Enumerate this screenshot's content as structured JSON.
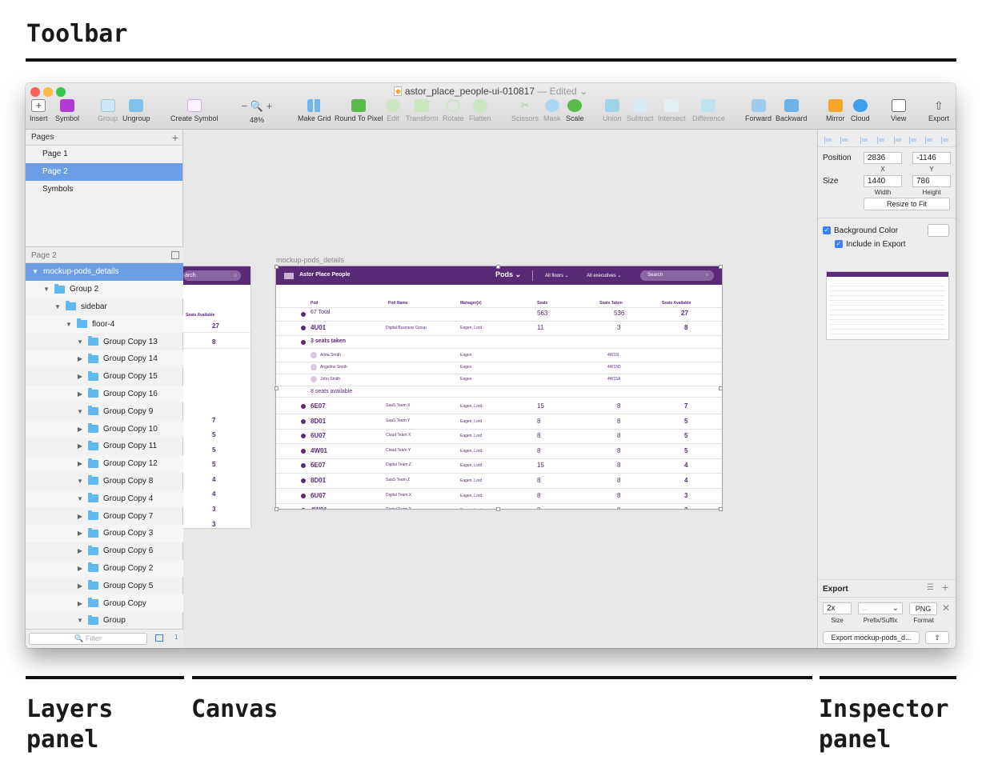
{
  "annotations": {
    "toolbar_heading": "Toolbar",
    "layers_heading": "Layers panel",
    "canvas_heading": "Canvas",
    "inspector_heading": "Inspector panel"
  },
  "window": {
    "title": "astor_place_people-ui-010817",
    "edited": "— Edited",
    "traffic_colors": [
      "#fc605b",
      "#fdbc40",
      "#34c84a"
    ]
  },
  "toolbar": {
    "insert": "Insert",
    "symbol": "Symbol",
    "group": "Group",
    "ungroup": "Ungroup",
    "create_symbol": "Create Symbol",
    "zoom": "48%",
    "make_grid": "Make Grid",
    "round_to_pixel": "Round To Pixel",
    "edit": "Edit",
    "transform": "Transform",
    "rotate": "Rotate",
    "flatten": "Flatten",
    "scissors": "Scissors",
    "mask": "Mask",
    "scale": "Scale",
    "union": "Union",
    "subtract": "Subtract",
    "intersect": "Intersect",
    "difference": "Difference",
    "forward": "Forward",
    "backward": "Backward",
    "mirror": "Mirror",
    "cloud": "Cloud",
    "view": "View",
    "export": "Export"
  },
  "layers_panel": {
    "pages_header": "Pages",
    "pages": [
      "Page 1",
      "Page 2",
      "Symbols"
    ],
    "selected_page": "Page 2",
    "current_page_label": "Page 2",
    "layers": [
      {
        "name": "mockup-pods_details",
        "level": 0,
        "expanded": true,
        "selected": true
      },
      {
        "name": "Group 2",
        "level": 1,
        "expanded": true
      },
      {
        "name": "sidebar",
        "level": 2,
        "expanded": true
      },
      {
        "name": "floor-4",
        "level": 3,
        "expanded": true
      },
      {
        "name": "Group Copy 13",
        "level": 4,
        "expanded": true
      },
      {
        "name": "Group Copy 14",
        "level": 4,
        "expanded": false
      },
      {
        "name": "Group Copy 15",
        "level": 4,
        "expanded": false
      },
      {
        "name": "Group Copy 16",
        "level": 4,
        "expanded": false
      },
      {
        "name": "Group Copy 9",
        "level": 4,
        "expanded": true
      },
      {
        "name": "Group Copy 10",
        "level": 4,
        "expanded": false
      },
      {
        "name": "Group Copy 11",
        "level": 4,
        "expanded": false
      },
      {
        "name": "Group Copy 12",
        "level": 4,
        "expanded": false
      },
      {
        "name": "Group Copy 8",
        "level": 4,
        "expanded": true
      },
      {
        "name": "Group Copy 4",
        "level": 4,
        "expanded": true
      },
      {
        "name": "Group Copy 7",
        "level": 4,
        "expanded": false
      },
      {
        "name": "Group Copy 3",
        "level": 4,
        "expanded": false
      },
      {
        "name": "Group Copy 6",
        "level": 4,
        "expanded": false
      },
      {
        "name": "Group Copy 2",
        "level": 4,
        "expanded": false
      },
      {
        "name": "Group Copy 5",
        "level": 4,
        "expanded": false
      },
      {
        "name": "Group Copy",
        "level": 4,
        "expanded": false
      },
      {
        "name": "Group",
        "level": 4,
        "expanded": true
      }
    ],
    "filter_placeholder": "Filter",
    "filter_count": "1"
  },
  "canvas": {
    "artboard_label": "mockup-pods_details",
    "left_artboard": {
      "search": "arch",
      "col_header": "Seats Available",
      "values": [
        "27",
        "8",
        "7",
        "5",
        "5",
        "5",
        "4",
        "4",
        "3",
        "3"
      ]
    },
    "app": {
      "brand": "Astor Place People",
      "nav": "Pods",
      "filter_floors": "All floors",
      "filter_execs": "All executives",
      "search": "Search",
      "headers": [
        "Pod",
        "Pod Name",
        "Manager(s)",
        "Seats",
        "Seats Taken",
        "Seats Available"
      ],
      "total_row": {
        "label": "67 Total",
        "seats": "563",
        "taken": "536",
        "available": "27"
      },
      "expanded_pod": {
        "pod": "4U01",
        "name": "Digital Business Group",
        "manager": "Eagen, Lord",
        "seats": "11",
        "taken": "3",
        "available": "8"
      },
      "seats_taken_label": "3 seats taken",
      "people": [
        {
          "name": "Anna Smith",
          "manager": "Eagen",
          "seat": "4W15I"
        },
        {
          "name": "Angeline Smith",
          "manager": "Eagen",
          "seat": "4W15D"
        },
        {
          "name": "John Smith",
          "manager": "Eagen",
          "seat": "4W15A"
        }
      ],
      "seats_available_label": "8 seats available",
      "pods": [
        {
          "pod": "6E07",
          "name": "SaaS Team X",
          "manager": "Eagen, Lord",
          "seats": "15",
          "taken": "8",
          "available": "7"
        },
        {
          "pod": "8D01",
          "name": "SaaS Team Y",
          "manager": "Eagen, Lord",
          "seats": "8",
          "taken": "8",
          "available": "5"
        },
        {
          "pod": "6U07",
          "name": "Cloud Team X",
          "manager": "Eagen, Lord",
          "seats": "8",
          "taken": "8",
          "available": "5"
        },
        {
          "pod": "4W01",
          "name": "Cloud Team Y",
          "manager": "Eagen, Lord",
          "seats": "8",
          "taken": "8",
          "available": "5"
        },
        {
          "pod": "6E07",
          "name": "Digital Team Z",
          "manager": "Eagen, Lord",
          "seats": "15",
          "taken": "8",
          "available": "4"
        },
        {
          "pod": "8D01",
          "name": "SaaS Team Z",
          "manager": "Eagen, Lord",
          "seats": "8",
          "taken": "8",
          "available": "4"
        },
        {
          "pod": "6U07",
          "name": "Digital Team X",
          "manager": "Eagen, Lord",
          "seats": "8",
          "taken": "8",
          "available": "3"
        },
        {
          "pod": "4W01",
          "name": "Digital Team Y",
          "manager": "Eagen, Lord",
          "seats": "8",
          "taken": "8",
          "available": "3"
        }
      ],
      "brand_color": "#5b2a76"
    }
  },
  "inspector": {
    "position_label": "Position",
    "position_x": "2836",
    "position_y": "-1146",
    "x_label": "X",
    "y_label": "Y",
    "size_label": "Size",
    "width": "1440",
    "height": "786",
    "width_label": "Width",
    "height_label": "Height",
    "resize_button": "Resize to Fit",
    "background_color_label": "Background Color",
    "include_in_export_label": "Include in Export",
    "export_header": "Export",
    "export_size": "2x",
    "export_prefix": "...",
    "export_format": "PNG",
    "size_sub": "Size",
    "prefix_sub": "Prefix/Suffix",
    "format_sub": "Format",
    "export_button": "Export mockup-pods_d..."
  }
}
